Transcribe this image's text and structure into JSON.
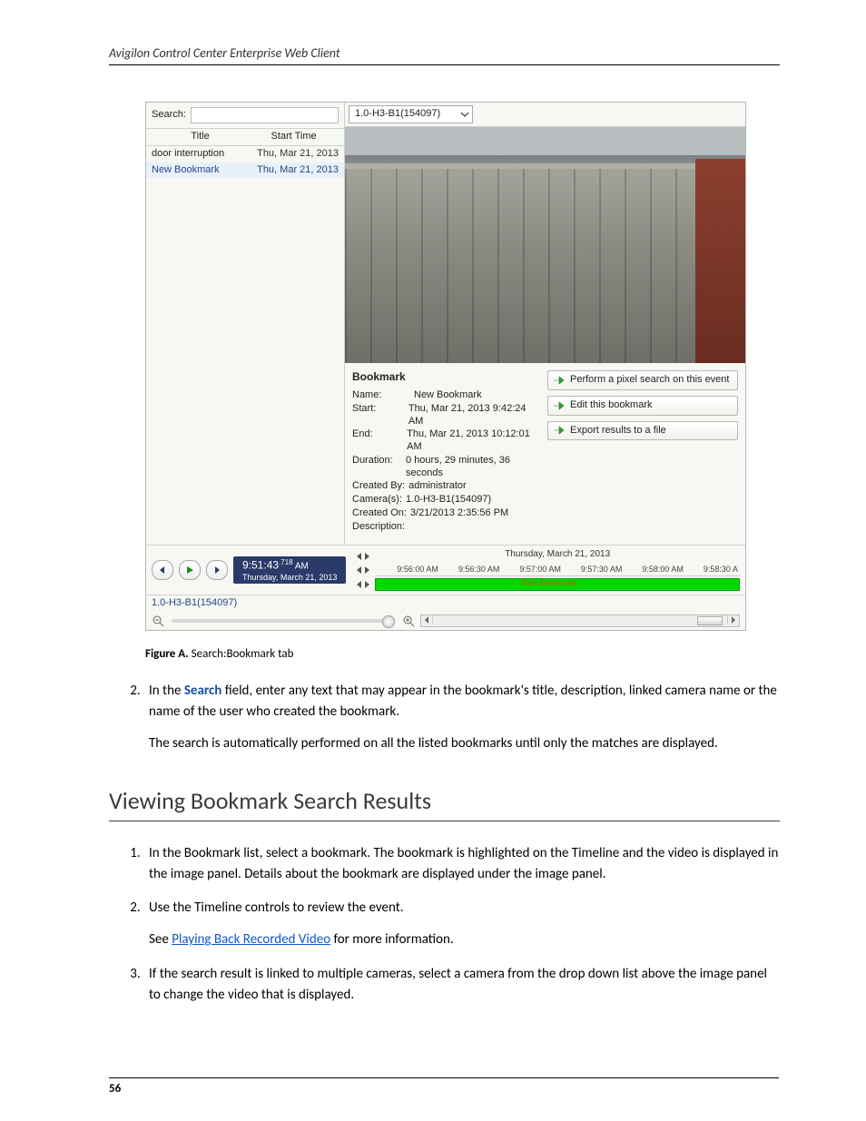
{
  "header": {
    "title": "Avigilon Control Center Enterprise Web Client"
  },
  "figure": {
    "caption_prefix": "Figure A.",
    "caption_text": "Search:Bookmark tab"
  },
  "app": {
    "search_label": "Search:",
    "search_value": "",
    "columns": {
      "title": "Title",
      "start": "Start Time"
    },
    "rows": [
      {
        "title": "door interruption",
        "start": "Thu, Mar 21, 2013",
        "selected": false
      },
      {
        "title": "New Bookmark",
        "start": "Thu, Mar 21, 2013",
        "selected": true
      }
    ],
    "camera_select": "1.0-H3-B1(154097)",
    "bookmark": {
      "heading": "Bookmark",
      "name_label": "Name:",
      "name": "New Bookmark",
      "start_label": "Start:",
      "start": "Thu, Mar 21, 2013 9:42:24 AM",
      "end_label": "End:",
      "end": "Thu, Mar 21, 2013 10:12:01 AM",
      "duration_label": "Duration:",
      "duration": "0 hours, 29 minutes, 36 seconds",
      "created_by_label": "Created By:",
      "created_by": "administrator",
      "cameras_label": "Camera(s):",
      "cameras": "1.0-H3-B1(154097)",
      "created_on_label": "Created On:",
      "created_on": "3/21/2013 2:35:56 PM",
      "description_label": "Description:"
    },
    "actions": {
      "pixel_search": "Perform a pixel search on this event",
      "edit_bookmark": "Edit this bookmark",
      "export_results": "Export results to a file"
    },
    "playback": {
      "time_main": "9:51:43",
      "time_frac": ".718",
      "time_ampm": "AM",
      "date": "Thursday, March 21, 2013"
    },
    "timeline": {
      "day_label": "Thursday, March 21, 2013",
      "ticks": [
        "9:56:00 AM",
        "9:56:30 AM",
        "9:57:00 AM",
        "9:57:30 AM",
        "9:58:00 AM",
        "9:58:30 A"
      ],
      "marker_label": "New Bookmark"
    },
    "camera_row_label": "1.0-H3-B1(154097)"
  },
  "body": {
    "list1_item2_a": "In the ",
    "list1_item2_search": "Search",
    "list1_item2_b": " field, enter any text that may appear in the bookmark's title, description, linked camera name or the name of the user who created the bookmark.",
    "list1_item2_p2": "The search is automatically performed on all the listed bookmarks until only the matches are displayed.",
    "section_heading": "Viewing Bookmark Search Results",
    "list2_item1": "In the Bookmark list, select a bookmark. The bookmark is highlighted on the Timeline and the video is displayed in the image panel. Details about the bookmark are displayed under the image panel.",
    "list2_item2": "Use the Timeline controls to review the event.",
    "list2_item2_see_a": "See ",
    "list2_item2_link": "Playing Back Recorded Video",
    "list2_item2_see_b": " for more information.",
    "list2_item3": "If the search result is linked to multiple cameras, select a camera from the drop down list above the image panel to change the video that is displayed."
  },
  "page_number": "56"
}
